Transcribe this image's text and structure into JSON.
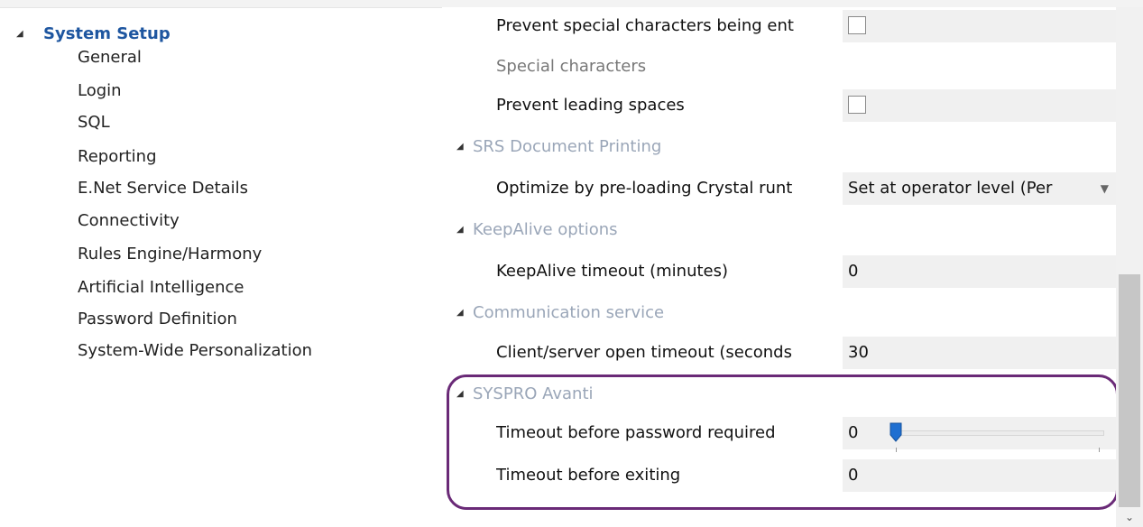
{
  "tree": {
    "root_label": "System Setup",
    "items": [
      "General",
      "Login",
      "SQL",
      "Reporting",
      "E.Net Service Details",
      "Connectivity",
      "Rules Engine/Harmony",
      "Artificial Intelligence",
      "Password Definition",
      "System-Wide Personalization"
    ]
  },
  "grid": {
    "prevent_special": {
      "label": "Prevent special characters being ent",
      "checked": false
    },
    "special_characters": {
      "label": "Special characters"
    },
    "prevent_leading": {
      "label": "Prevent leading spaces",
      "checked": false
    },
    "cat_srs": "SRS Document Printing",
    "optimize": {
      "label": "Optimize by pre-loading Crystal runt",
      "value": "Set at operator level (Per"
    },
    "cat_keepalive": "KeepAlive options",
    "keepalive_timeout": {
      "label": "KeepAlive timeout (minutes)",
      "value": "0"
    },
    "cat_comm": "Communication service",
    "client_server": {
      "label": "Client/server open timeout (seconds",
      "value": "30"
    },
    "cat_avanti": "SYSPRO Avanti",
    "timeout_password": {
      "label": "Timeout before password required",
      "value": "0",
      "slider_level": 0
    },
    "timeout_exit": {
      "label": "Timeout before exiting",
      "value": "0"
    }
  },
  "colors": {
    "tree_root": "#1e56a0",
    "category_text": "#9aa6b8",
    "highlight_border": "#6a2a77",
    "slider_thumb": "#1f6fd1"
  },
  "icons": {
    "expander": "triangle-down-icon",
    "dropdown": "chevron-down-icon",
    "scroll_down": "chevron-down-icon"
  }
}
